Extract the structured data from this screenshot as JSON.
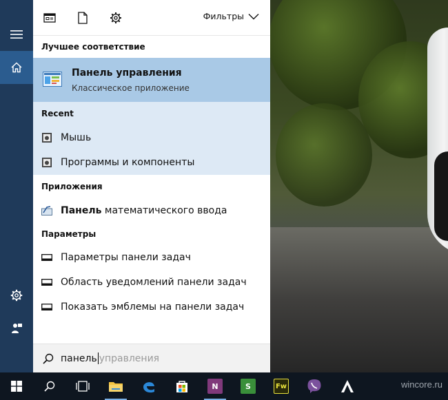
{
  "toolbar": {
    "filters_label": "Фильтры"
  },
  "best_match": {
    "header": "Лучшее соответствие",
    "name": "Панель управления",
    "subtitle": "Классическое приложение"
  },
  "recent": {
    "header": "Recent",
    "items": [
      {
        "label": "Мышь",
        "icon": "control-panel-icon"
      },
      {
        "label": "Программы и компоненты",
        "icon": "control-panel-icon"
      }
    ]
  },
  "apps": {
    "header": "Приложения",
    "items": [
      {
        "label_bold": "Панель",
        "label_rest": " математического ввода",
        "icon": "math-input-icon"
      }
    ]
  },
  "settings": {
    "header": "Параметры",
    "items": [
      {
        "label": "Параметры панели задач",
        "icon": "taskbar-settings-icon"
      },
      {
        "label": "Область уведомлений панели задач",
        "icon": "taskbar-settings-icon"
      },
      {
        "label": "Показать эмблемы на панели задач",
        "icon": "taskbar-settings-icon"
      }
    ]
  },
  "search": {
    "typed": "панель",
    "suggestion": " управления"
  },
  "taskbar": {
    "apps": [
      "windows-start",
      "search",
      "task-view",
      "file-explorer",
      "edge",
      "store",
      "onenote",
      "sway",
      "fireworks",
      "viber",
      "inkscape"
    ],
    "watermark": "wincore.ru"
  },
  "colors": {
    "rail": "#1f3a5a",
    "rail_active": "#2b5c8f",
    "best_match_bg": "#a9c9e6",
    "recent_bg": "#dde9f5",
    "taskbar": "#0e1620"
  }
}
